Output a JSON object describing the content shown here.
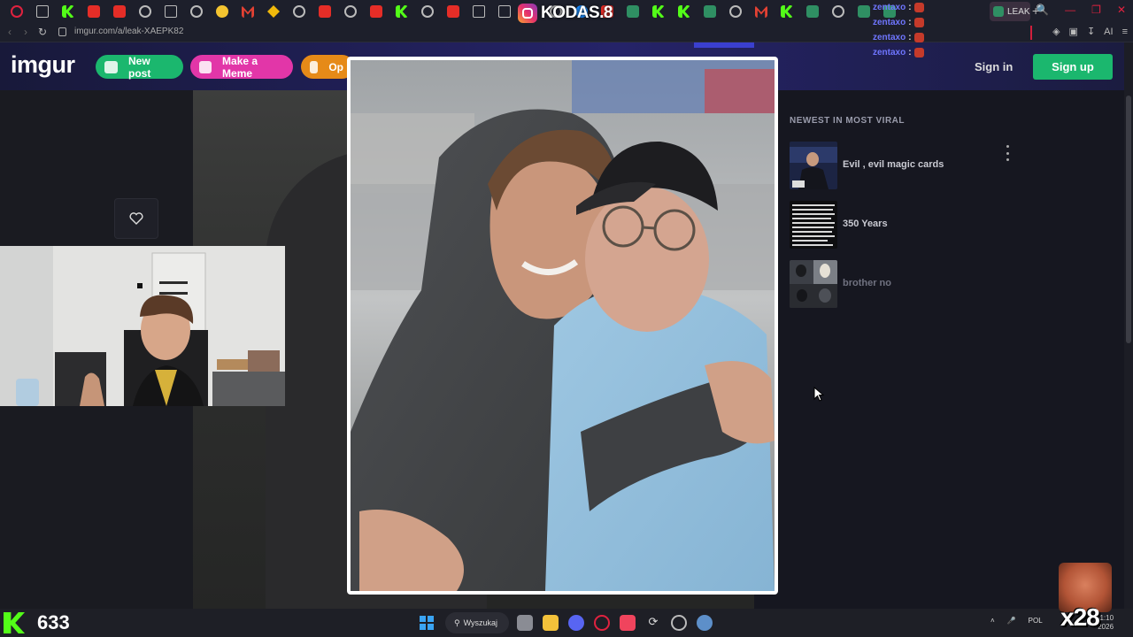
{
  "browser": {
    "url": "imgur.com/a/leak-XAEPK82",
    "active_tab_label": "LEAK",
    "new_tab_symbol": "+",
    "tab_icons": [
      "opera-icon",
      "mail-icon",
      "kick-icon",
      "youtube-icon",
      "youtube-icon",
      "chrome-icon",
      "window-icon",
      "chrome-icon",
      "emoji-icon",
      "gmail-icon",
      "binance-icon",
      "settings-icon",
      "youtube-icon",
      "chrome-icon",
      "youtube-icon",
      "kick-icon",
      "chrome-icon",
      "youtube-icon",
      "grid-icon",
      "window-icon",
      "sheets-icon",
      "chrome-icon",
      "globe-icon",
      "youtube-icon",
      "sheets-icon",
      "kick-icon",
      "kick-icon",
      "sheets-icon",
      "chrome-icon",
      "gmail-icon",
      "kick-icon",
      "sheets-icon",
      "chrome-icon",
      "sheets-icon",
      "sheets-icon"
    ],
    "ai_label": "AI",
    "window_controls": [
      "🔍",
      "—",
      "❐",
      "✕"
    ]
  },
  "header": {
    "logo": "imgur",
    "new_post": "New post",
    "make_meme": "Make a Meme",
    "opera_label": "Op",
    "sign_in": "Sign in",
    "sign_up": "Sign up"
  },
  "sidebar": {
    "title": "NEWEST IN MOST VIRAL",
    "items": [
      {
        "label": "Evil , evil magic cards"
      },
      {
        "label": "350 Years"
      },
      {
        "label": "brother no"
      }
    ]
  },
  "stream": {
    "instagram_handle": "KODAS.8",
    "chat": [
      {
        "user": "zentaxo",
        "sep": ":"
      },
      {
        "user": "zentaxo",
        "sep": ":"
      },
      {
        "user": "zentaxo",
        "sep": ":"
      },
      {
        "user": "zentaxo",
        "sep": ":"
      }
    ],
    "viewer_count": "633",
    "sub_multiplier": "x28"
  },
  "taskbar": {
    "search_label": "Wyszukaj",
    "language": "POL",
    "clock_time": "21:10",
    "clock_date": "2026"
  },
  "colors": {
    "green": "#1bb76e",
    "pink": "#e236a8",
    "orange": "#e68a18",
    "kick": "#53fc18"
  }
}
